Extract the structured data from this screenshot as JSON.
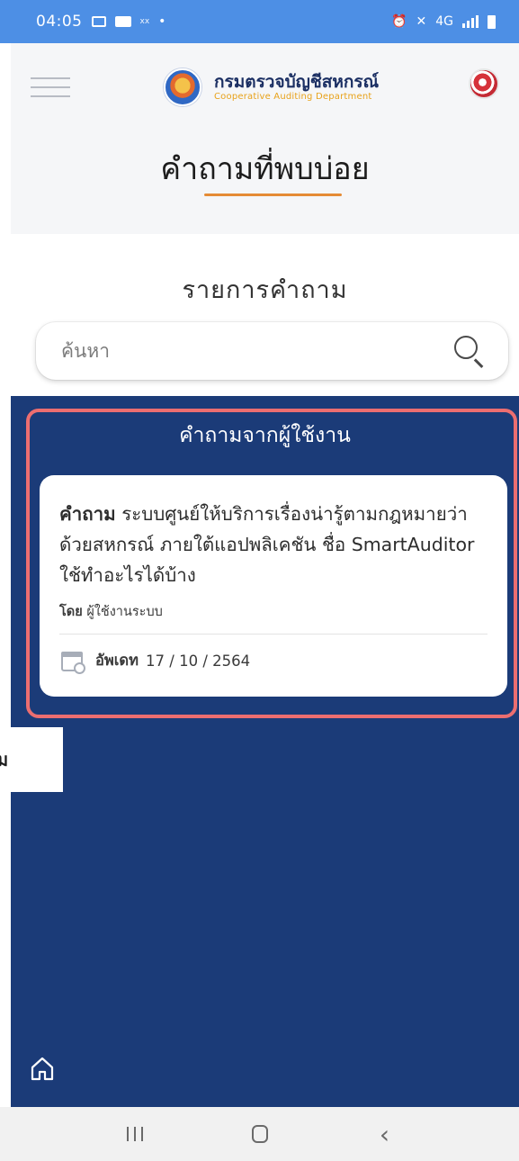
{
  "status_bar": {
    "time": "04:05",
    "mini_label": "xx",
    "network": "4G"
  },
  "header": {
    "logo_title": "กรมตรวจบัญชีสหกรณ์",
    "logo_subtitle": "Cooperative Auditing Department",
    "page_title": "คำถามที่พบบ่อย"
  },
  "section": {
    "title": "รายการคำถาม"
  },
  "search": {
    "placeholder": "ค้นหา"
  },
  "user_questions": {
    "title": "คำถามจากผู้ใช้งาน",
    "items": [
      {
        "label": "คำถาม",
        "question": "ระบบศูนย์ให้บริการเรื่องน่ารู้ตามกฎหมายว่าด้วยสหกรณ์  ภายใต้แอปพลิเคชัน ชื่อ SmartAuditor ใช้ทำอะไรได้บ้าง",
        "author_label": "โดย",
        "author": "ผู้ใช้งานระบบ",
        "date_label": "อัพเดท",
        "date": "17 / 10 / 2564"
      }
    ]
  },
  "tooltip": {
    "text": "ม"
  },
  "colors": {
    "status_bar": "#4d8fe5",
    "panel": "#1b3b78",
    "highlight": "#ec6e70",
    "accent_underline": "#e58b35"
  },
  "icons": [
    "hamburger-icon",
    "logo-seal",
    "avatar",
    "search-icon",
    "calendar-icon",
    "home-icon",
    "recents-icon",
    "home-button-icon",
    "back-icon"
  ]
}
